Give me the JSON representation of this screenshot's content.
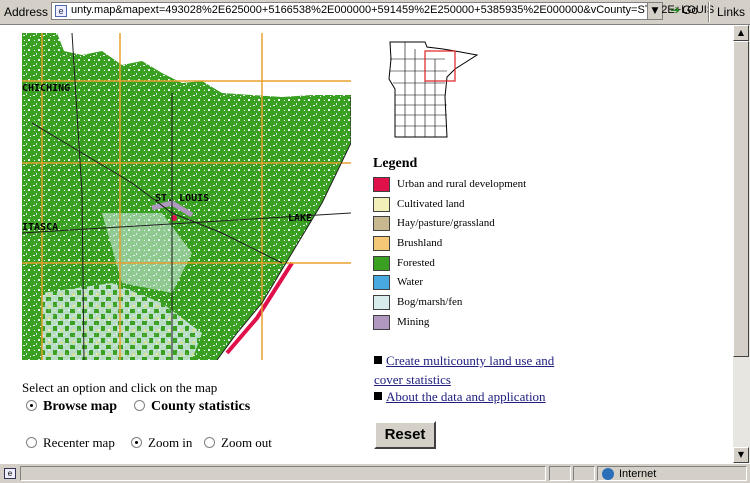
{
  "address_bar": {
    "label": "Address",
    "url": "unty.map&mapext=493028%2E625000+5166538%2E000000+591459%2E250000+5385935%2E000000&vCounty=ST%2E+LOUIS",
    "go_label": "Go",
    "links_label": "Links"
  },
  "map": {
    "place_labels": [
      "CHICHING",
      "ST. LOUIS",
      "ITASCA",
      "LAKE"
    ]
  },
  "legend": {
    "title": "Legend",
    "items": [
      {
        "label": "Urban and rural development",
        "color": "#e0104a"
      },
      {
        "label": "Cultivated land",
        "color": "#f2f0b8"
      },
      {
        "label": "Hay/pasture/grassland",
        "color": "#c8b890"
      },
      {
        "label": "Brushland",
        "color": "#f5c878"
      },
      {
        "label": "Forested",
        "color": "#3aa022"
      },
      {
        "label": "Water",
        "color": "#48a8e0"
      },
      {
        "label": "Bog/marsh/fen",
        "color": "#d8ecec"
      },
      {
        "label": "Mining",
        "color": "#b098c0"
      }
    ]
  },
  "links": {
    "create_multicounty_line1": "Create multicounty land use and",
    "create_multicounty_line2": "cover statistics",
    "about": "About the data and application"
  },
  "buttons": {
    "reset": "Reset"
  },
  "controls": {
    "instruction": "Select an option and click on the map",
    "mode_options": [
      "Browse map",
      "County statistics"
    ],
    "mode_selected": "Browse map",
    "tool_options": [
      "Recenter map",
      "Zoom in",
      "Zoom out"
    ],
    "tool_selected": "Zoom in"
  },
  "status_bar": {
    "zone": "Internet"
  }
}
